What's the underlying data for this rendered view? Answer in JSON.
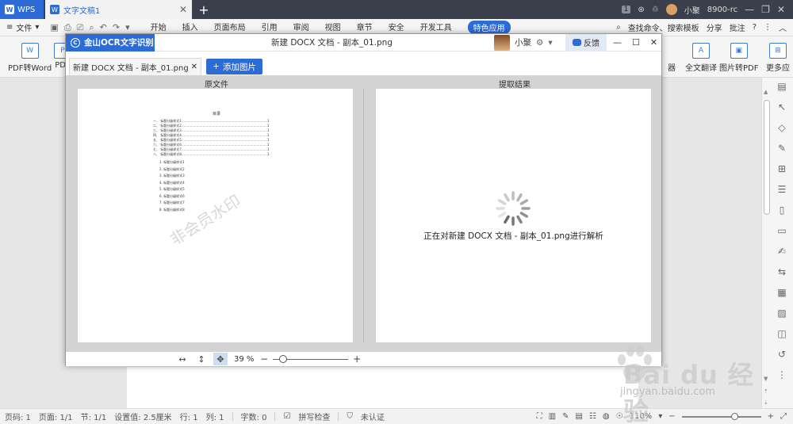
{
  "titlebar": {
    "app_tab": "WPS",
    "doc_tab": "文字文稿1",
    "add_tab": "+",
    "badge": "1",
    "username": "小聚",
    "version": "8900-rc",
    "min": "—",
    "max": "❐",
    "close": "✕"
  },
  "menubar": {
    "file": "文件",
    "menus": [
      "开始",
      "插入",
      "页面布局",
      "引用",
      "审阅",
      "视图",
      "章节",
      "安全",
      "开发工具",
      "特色应用"
    ],
    "search": "查找命令、搜索模板",
    "share": "分享",
    "comment": "批注",
    "help": "?"
  },
  "ribbon": {
    "left_items": [
      {
        "label": "PDF转Word",
        "icon": "pdf-word-icon"
      },
      {
        "label": "PDF",
        "icon": "pdf-icon"
      }
    ],
    "right_items": [
      {
        "label": "器",
        "icon": "tool-icon"
      },
      {
        "label": "全文翻译",
        "icon": "translate-icon"
      },
      {
        "label": "图片转PDF",
        "icon": "image-pdf-icon"
      },
      {
        "label": "更多应",
        "icon": "more-icon"
      }
    ]
  },
  "dialog": {
    "brand": "金山OCR文字识别",
    "filename": "新建 DOCX 文档 - 副本_01.png",
    "username": "小聚",
    "feedback": "反馈",
    "tab_label": "新建 DOCX 文档 - 副本_01.png",
    "add_image": "添加图片",
    "source_label": "原文件",
    "result_label": "提取结果",
    "watermark": "非会员水印",
    "parsing_text": "正在对新建 DOCX 文档 - 副本_01.png进行解析",
    "zoom_pct": "39 %",
    "doc_title": "目录",
    "doc_rows": [
      "一、 标题分级样式1………………………………………………………………………1",
      "二、 标题分级样式2………………………………………………………………………1",
      "三、 标题分级样式3………………………………………………………………………1",
      "四、 标题分级样式4………………………………………………………………………1",
      "五、 标题分级样式5………………………………………………………………………1",
      "六、 标题分级样式6………………………………………………………………………1",
      "七、 标题分级样式7………………………………………………………………………1",
      "八、 标题分级样式8………………………………………………………………………1"
    ],
    "doc_subrows": [
      "1. 标题分级样式1",
      "2. 标题分级样式2",
      "3. 标题分级样式3",
      "4. 标题分级样式4",
      "5. 标题分级样式5",
      "6. 标题分级样式6",
      "7. 标题分级样式7",
      "8. 标题分级样式8"
    ]
  },
  "statusbar": {
    "page_code": "页码: 1",
    "page": "页面: 1/1",
    "section": "节: 1/1",
    "setting": "设置值: 2.5厘米",
    "row": "行: 1",
    "col": "列: 1",
    "words": "字数: 0",
    "spell": "拼写检查",
    "cert": "未认证",
    "zoom": "110%",
    "zoom_out": "−",
    "zoom_in": "+"
  },
  "watermark_site": {
    "brand": "Bai du 经验",
    "url": "jingyan.baidu.com"
  },
  "colors": {
    "accent": "#2d6bd6",
    "titlebar_bg": "#3a3f4b",
    "dialog_body_bg": "#d3d3d3"
  }
}
